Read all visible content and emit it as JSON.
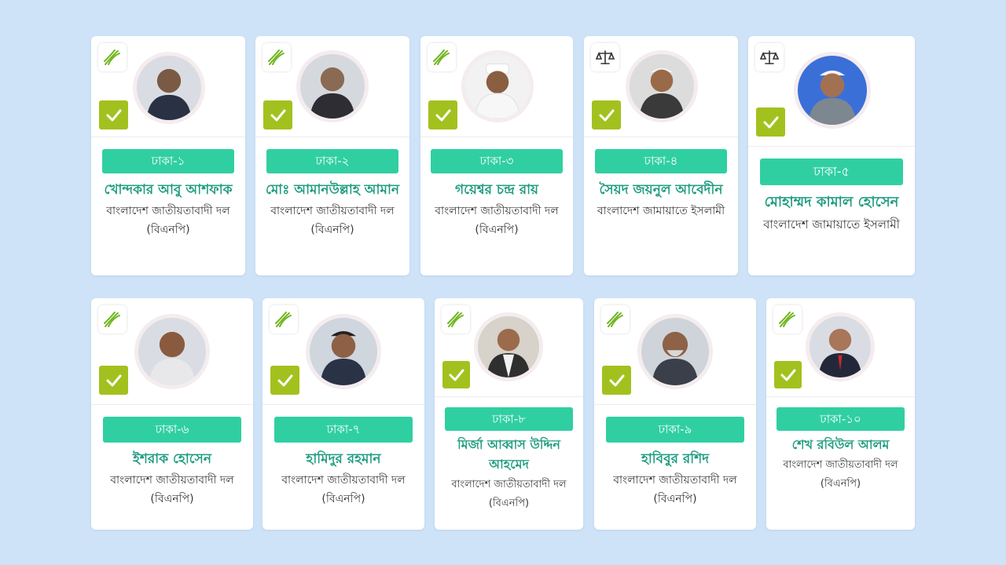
{
  "candidates": [
    {
      "seat": "ঢাকা-১",
      "name": "খোন্দকার আবু আশফাক",
      "party": "বাংলাদেশ জাতীয়তাবাদী দল (বিএনপি)",
      "symbol": "sheaf-of-paddy-icon",
      "winner": true
    },
    {
      "seat": "ঢাকা-২",
      "name": "মোঃ আমানউল্লাহ আমান",
      "party": "বাংলাদেশ জাতীয়তাবাদী দল (বিএনপি)",
      "symbol": "sheaf-of-paddy-icon",
      "winner": true
    },
    {
      "seat": "ঢাকা-৩",
      "name": "গয়েশ্বর চন্দ্র রায়",
      "party": "বাংলাদেশ জাতীয়তাবাদী দল (বিএনপি)",
      "symbol": "sheaf-of-paddy-icon",
      "winner": true
    },
    {
      "seat": "ঢাকা-৪",
      "name": "সৈয়দ জয়নুল আবেদীন",
      "party": "বাংলাদেশ জামায়াতে ইসলামী",
      "symbol": "scales-icon",
      "winner": true
    },
    {
      "seat": "ঢাকা-৫",
      "name": "মোহাম্মদ কামাল হোসেন",
      "party": "বাংলাদেশ জামায়াতে ইসলামী",
      "symbol": "scales-icon",
      "winner": true
    },
    {
      "seat": "ঢাকা-৬",
      "name": "ইশরাক হোসেন",
      "party": "বাংলাদেশ জাতীয়তাবাদী দল (বিএনপি)",
      "symbol": "sheaf-of-paddy-icon",
      "winner": true
    },
    {
      "seat": "ঢাকা-৭",
      "name": "হামিদুর রহমান",
      "party": "বাংলাদেশ জাতীয়তাবাদী দল (বিএনপি)",
      "symbol": "sheaf-of-paddy-icon",
      "winner": true
    },
    {
      "seat": "ঢাকা-৮",
      "name": "মির্জা আব্বাস উদ্দিন আহমেদ",
      "party": "বাংলাদেশ জাতীয়তাবাদী দল (বিএনপি)",
      "symbol": "sheaf-of-paddy-icon",
      "winner": true
    },
    {
      "seat": "ঢাকা-৯",
      "name": "হাবিবুর রশিদ",
      "party": "বাংলাদেশ জাতীয়তাবাদী দল (বিএনপি)",
      "symbol": "sheaf-of-paddy-icon",
      "winner": true
    },
    {
      "seat": "ঢাকা-১০",
      "name": "শেখ রবিউল আলম",
      "party": "বাংলাদেশ জাতীয়তাবাদী দল (বিএনপি)",
      "symbol": "sheaf-of-paddy-icon",
      "winner": true
    }
  ],
  "colors": {
    "background": "#cfe3f8",
    "seat_badge": "#30cfa2",
    "name_text": "#1f9c80",
    "check_badge": "#a3c11e",
    "paddy": "#6fb51e",
    "scales": "#333333"
  }
}
